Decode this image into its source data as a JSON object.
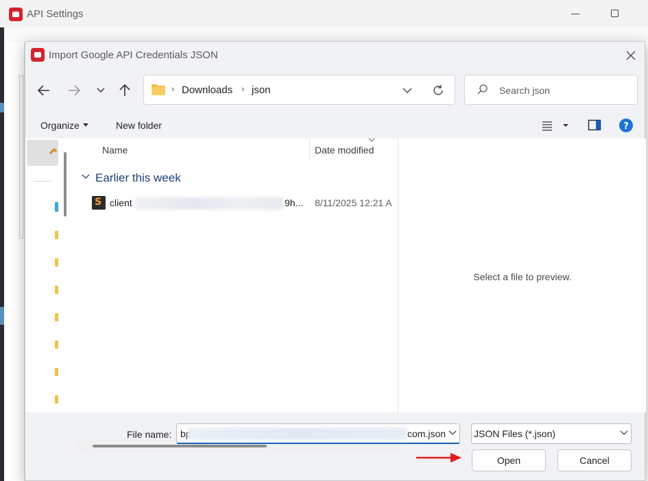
{
  "background_window": {
    "title": "API Settings"
  },
  "dialog": {
    "title": "Import Google API Credentials JSON",
    "accent_color": "#d3232f"
  },
  "address_bar": {
    "breadcrumbs": [
      "Downloads",
      "json"
    ]
  },
  "search": {
    "placeholder": "Search json"
  },
  "command_bar": {
    "organize": "Organize",
    "new_folder": "New folder"
  },
  "file_list": {
    "columns": [
      "Name",
      "Date modified"
    ],
    "group": "Earlier this week",
    "files": [
      {
        "name_start": "client",
        "name_end": "9h...",
        "date_modified": "8/11/2025 12:21 A"
      }
    ]
  },
  "preview": {
    "message": "Select a file to preview."
  },
  "bottom": {
    "file_name_label": "File name:",
    "file_name_start": "bp",
    "file_name_end": "com.json",
    "file_type": "JSON Files (*.json)",
    "open_label": "Open",
    "cancel_label": "Cancel"
  },
  "icons": {
    "back": "back-arrow-icon",
    "forward": "forward-arrow-icon",
    "recent": "chevron-down-icon",
    "up": "up-arrow-icon",
    "refresh": "refresh-icon",
    "search": "search-icon",
    "view": "view-options-icon",
    "preview_pane": "preview-pane-icon",
    "help": "help-icon",
    "close": "close-icon",
    "annotation": "red-arrow-icon"
  }
}
